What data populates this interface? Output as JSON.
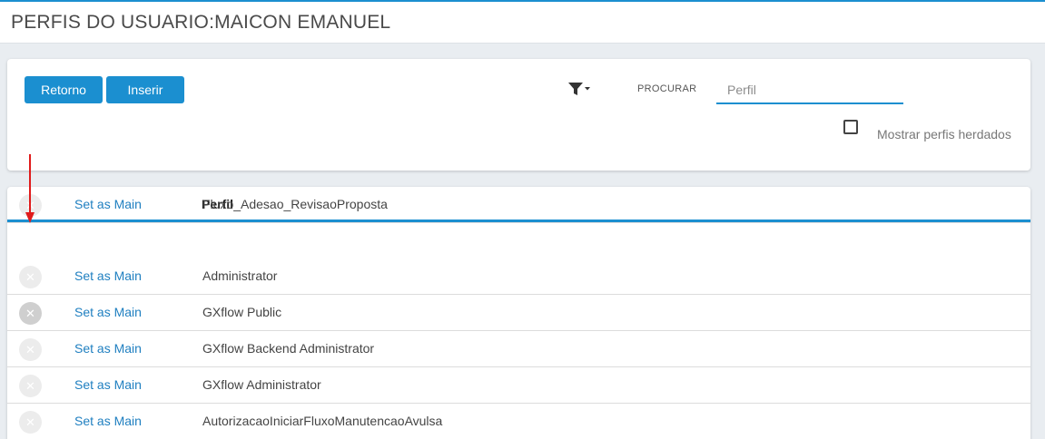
{
  "header": {
    "title": "PERFIS DO USUARIO:MAICON EMANUEL"
  },
  "toolbar": {
    "back_label": "Retorno",
    "insert_label": "Inserir",
    "search_label": "PROCURAR",
    "search_placeholder": "Perfil",
    "search_value": "",
    "show_inherited_label": "Mostrar perfis herdados",
    "show_inherited_checked": false
  },
  "table": {
    "columns": [
      "Perfil"
    ],
    "rows": [
      {
        "action": "Set as Main",
        "perfil": "Administrator"
      },
      {
        "action": "Set as Main",
        "perfil": "GXflow Public"
      },
      {
        "action": "Set as Main",
        "perfil": "GXflow Backend Administrator"
      },
      {
        "action": "Set as Main",
        "perfil": "GXflow Administrator"
      },
      {
        "action": "Set as Main",
        "perfil": "AutorizacaoIniciarFluxoManutencaoAvulsa"
      },
      {
        "action": "Set as Main",
        "perfil": "Fluxo_Adesao_RevisaoProposta"
      }
    ]
  },
  "colors": {
    "accent": "#1b8fd0",
    "link": "#1f7fc0",
    "annotation_arrow": "#e01b1b"
  }
}
